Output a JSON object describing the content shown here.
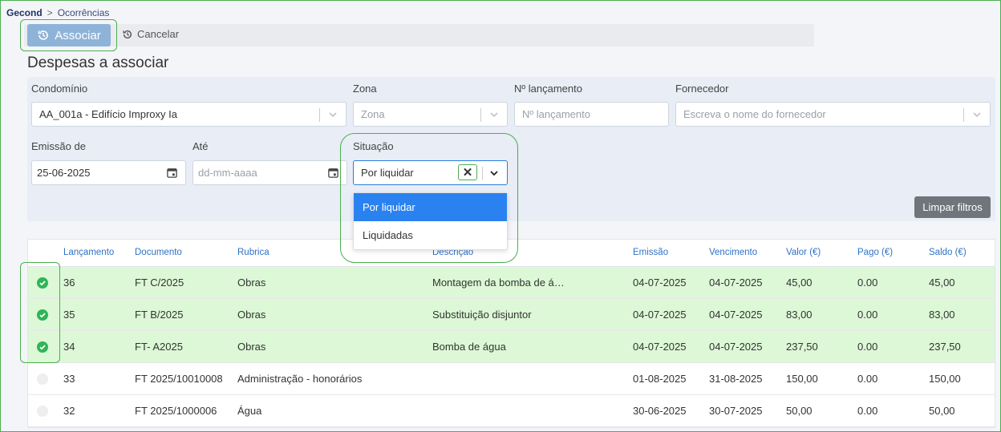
{
  "breadcrumb": {
    "root": "Gecond",
    "separator": ">",
    "leaf": "Ocorrências"
  },
  "toolbar": {
    "associar_label": "Associar",
    "cancelar_label": "Cancelar"
  },
  "page_title": "Despesas a associar",
  "filters": {
    "condominio": {
      "label": "Condomínio",
      "value": "AA_001a - Edifício Improxy Ia"
    },
    "zona": {
      "label": "Zona",
      "placeholder": "Zona"
    },
    "lancamento": {
      "label": "Nº lançamento",
      "placeholder": "Nº lançamento"
    },
    "fornecedor": {
      "label": "Fornecedor",
      "placeholder": "Escreva o nome do fornecedor"
    },
    "emissao_de": {
      "label": "Emissão de",
      "value": "25-06-2025"
    },
    "ate": {
      "label": "Até",
      "placeholder": "dd-mm-aaaa"
    },
    "situacao": {
      "label": "Situação",
      "value": "Por liquidar",
      "options": [
        "Por liquidar",
        "Liquidadas"
      ],
      "highlighted": "Por liquidar"
    },
    "limpar_label": "Limpar filtros"
  },
  "table": {
    "headers": [
      "Lançamento",
      "Documento",
      "Rubrica",
      "Descrição",
      "Emissão",
      "Vencimento",
      "Valor (€)",
      "Pago (€)",
      "Saldo (€)"
    ],
    "rows": [
      {
        "selected": true,
        "lancamento": "36",
        "documento": "FT C/2025",
        "rubrica": "Obras",
        "descricao": "Montagem da bomba de á…",
        "emissao": "04-07-2025",
        "vencimento": "04-07-2025",
        "valor": "45,00",
        "pago": "0.00",
        "saldo": "45,00"
      },
      {
        "selected": true,
        "lancamento": "35",
        "documento": "FT B/2025",
        "rubrica": "Obras",
        "descricao": "Substituição disjuntor",
        "emissao": "04-07-2025",
        "vencimento": "04-07-2025",
        "valor": "83,00",
        "pago": "0.00",
        "saldo": "83,00"
      },
      {
        "selected": true,
        "lancamento": "34",
        "documento": "FT- A2025",
        "rubrica": "Obras",
        "descricao": "Bomba de água",
        "emissao": "04-07-2025",
        "vencimento": "04-07-2025",
        "valor": "237,50",
        "pago": "0.00",
        "saldo": "237,50"
      },
      {
        "selected": false,
        "lancamento": "33",
        "documento": "FT 2025/10010008",
        "rubrica": "Administração - honorários",
        "descricao": "",
        "emissao": "01-08-2025",
        "vencimento": "31-08-2025",
        "valor": "150,00",
        "pago": "0.00",
        "saldo": "150,00"
      },
      {
        "selected": false,
        "lancamento": "32",
        "documento": "FT 2025/1000006",
        "rubrica": "Água",
        "descricao": "",
        "emissao": "30-06-2025",
        "vencimento": "30-07-2025",
        "valor": "50,00",
        "pago": "0.00",
        "saldo": "50,00"
      }
    ]
  },
  "colors": {
    "accent": "#2a82f0",
    "selected_row": "#dcf8d6",
    "check_on": "#2fb457",
    "header_text": "#2f72c4",
    "highlight": "#4caf50"
  }
}
